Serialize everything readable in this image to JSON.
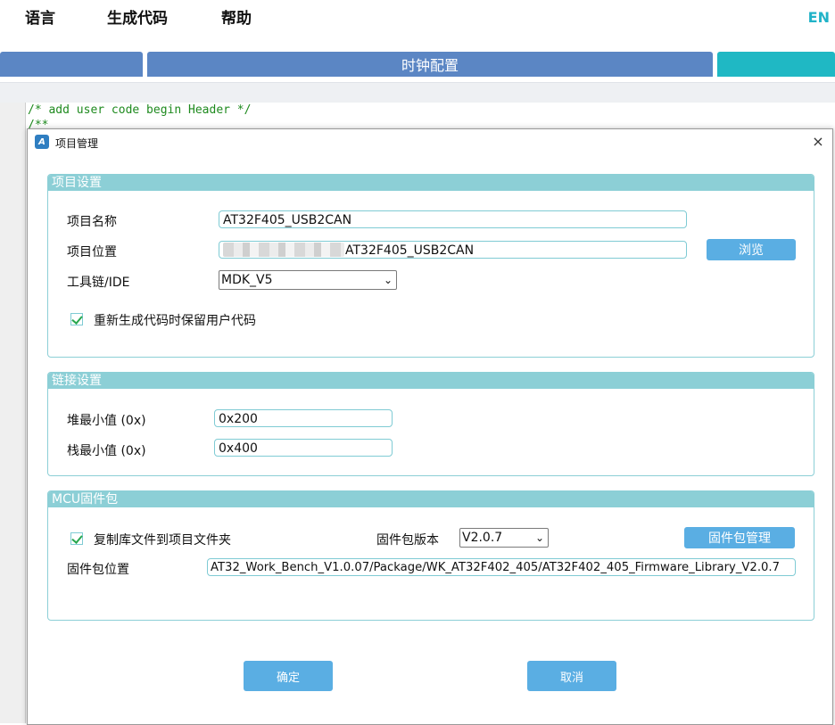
{
  "menu": {
    "language": "语言",
    "generate_code": "生成代码",
    "help": "帮助",
    "lang_toggle": "EN"
  },
  "tabs": {
    "clock_config": "时钟配置"
  },
  "editor": {
    "lines": [
      "/* add user code begin Header */",
      "/**"
    ]
  },
  "dialog": {
    "title": "项目管理",
    "close": "×",
    "project_settings": {
      "header": "项目设置",
      "name_label": "项目名称",
      "name_value": "AT32F405_USB2CAN",
      "location_label": "项目位置",
      "location_value": "AT32F405_USB2CAN",
      "browse_label": "浏览",
      "toolchain_label": "工具链/IDE",
      "toolchain_value": "MDK_V5",
      "keep_user_code_label": "重新生成代码时保留用户代码",
      "keep_user_code_checked": true
    },
    "link_settings": {
      "header": "链接设置",
      "heap_label": "堆最小值 (0x)",
      "heap_value": "0x200",
      "stack_label": "栈最小值 (0x)",
      "stack_value": "0x400"
    },
    "firmware": {
      "header": "MCU固件包",
      "copy_lib_label": "复制库文件到项目文件夹",
      "copy_lib_checked": true,
      "version_label": "固件包版本",
      "version_value": "V2.0.7",
      "manage_label": "固件包管理",
      "location_label": "固件包位置",
      "location_value": "AT32_Work_Bench_V1.0.07/Package/WK_AT32F402_405/AT32F402_405_Firmware_Library_V2.0.7"
    },
    "ok_label": "确定",
    "cancel_label": "取消"
  },
  "colors": {
    "accent": "#5aaee3",
    "group_header": "#8ccfd6",
    "tab_blue": "#5b86c4",
    "tab_teal": "#1fb8c4"
  },
  "icons": {
    "app": "app-logo-icon",
    "check": "check-icon",
    "chevron": "chevron-down-icon"
  }
}
